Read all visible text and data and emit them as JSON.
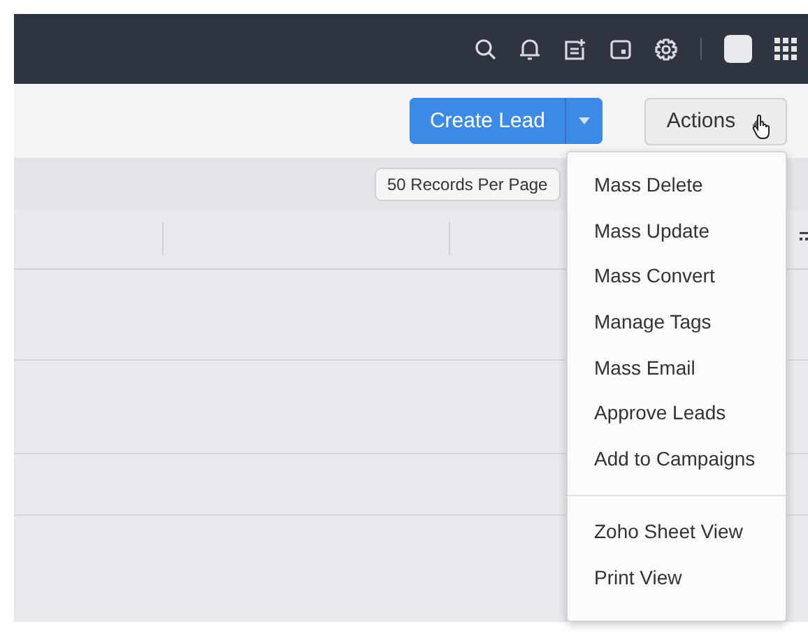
{
  "toolbar": {
    "create_button": {
      "label": "Create Lead"
    },
    "actions_button": {
      "label": "Actions",
      "expanded": true
    }
  },
  "records_per_page": "50 Records Per Page",
  "actions_menu": {
    "groups": [
      [
        "Mass Delete",
        "Mass Update",
        "Mass Convert",
        "Manage Tags",
        "Mass Email",
        "Approve Leads",
        "Add to Campaigns"
      ],
      [
        "Zoho Sheet View",
        "Print View"
      ]
    ]
  }
}
